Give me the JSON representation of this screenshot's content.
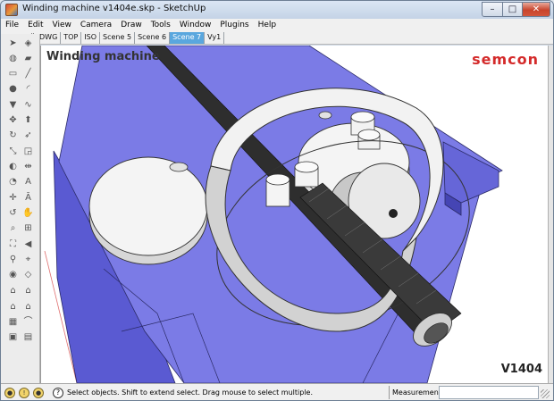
{
  "window": {
    "title": "Winding machine v1404e.skp - SketchUp",
    "controls": {
      "minimize": "–",
      "maximize": "□",
      "close": "✕"
    }
  },
  "menu": [
    "File",
    "Edit",
    "View",
    "Camera",
    "Draw",
    "Tools",
    "Window",
    "Plugins",
    "Help"
  ],
  "scene_tabs": {
    "items": [
      "DWG",
      "TOP",
      "ISO",
      "Scene 5",
      "Scene 6",
      "Scene 7",
      "Vy1"
    ],
    "active": "Scene 7",
    "active_color": "#5aa7de"
  },
  "viewport": {
    "model_title": "Winding machine",
    "brand_text": "semcon",
    "brand_color": "#d42a2a",
    "version_label": "V1404",
    "platform_color": "#7b7be6"
  },
  "toolbar": {
    "tools": [
      "select-arrow-icon",
      "component-icon",
      "paint-bucket-icon",
      "eraser-icon",
      "rectangle-icon",
      "line-icon",
      "circle-icon",
      "arc-icon",
      "polygon-icon",
      "freehand-icon",
      "move-icon",
      "push-pull-icon",
      "rotate-icon",
      "follow-me-icon",
      "scale-icon",
      "offset-icon",
      "tape-measure-icon",
      "dimension-icon",
      "protractor-icon",
      "text-icon",
      "axes-icon",
      "3d-text-icon",
      "orbit-icon",
      "pan-icon",
      "zoom-icon",
      "zoom-window-icon",
      "zoom-extents-icon",
      "previous-view-icon",
      "walk-icon",
      "position-camera-icon",
      "look-around-icon",
      "section-plane-icon",
      "house-warehouse-icon",
      "house-get-models-icon",
      "house-share-icon",
      "house-component-icon",
      "sandbox-icon",
      "smoove-icon",
      "stamp-icon",
      "drape-icon"
    ]
  },
  "statusbar": {
    "hint": "Select objects. Shift to extend select. Drag mouse to select multiple.",
    "measurements_label": "Measurements",
    "measurements_value": ""
  }
}
